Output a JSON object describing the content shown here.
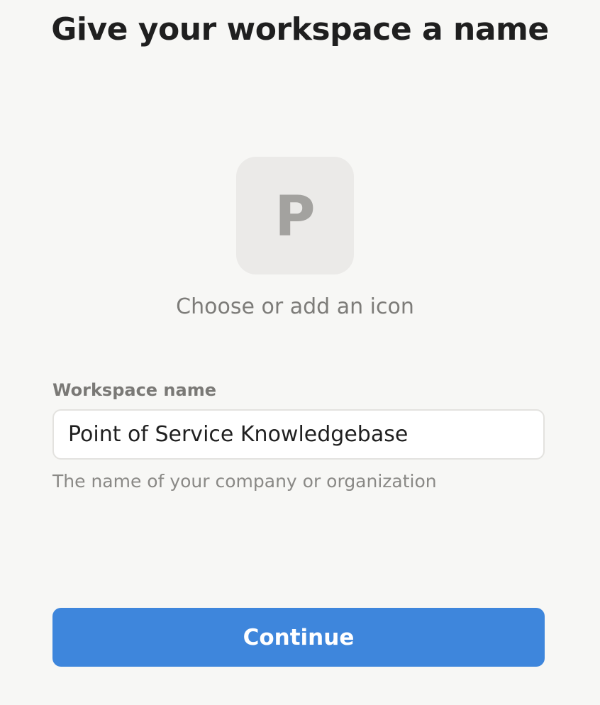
{
  "page": {
    "title": "Give your workspace a name"
  },
  "icon_picker": {
    "letter": "P",
    "caption": "Choose or add an icon"
  },
  "workspace_name": {
    "label": "Workspace name",
    "value": "Point of Service Knowledgebase",
    "help": "The name of your company or organization"
  },
  "actions": {
    "continue_label": "Continue"
  },
  "colors": {
    "background": "#f7f7f5",
    "accent": "#3e86dc",
    "icon_tile": "#ebeae8"
  }
}
